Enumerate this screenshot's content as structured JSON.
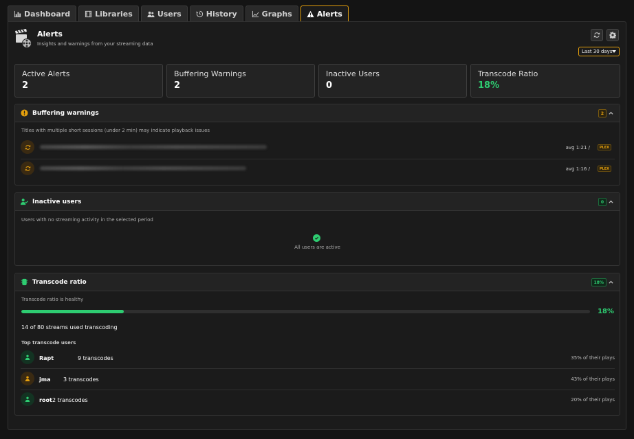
{
  "nav": {
    "tabs": [
      {
        "label": "Dashboard",
        "icon": "bar-chart-icon"
      },
      {
        "label": "Libraries",
        "icon": "film-icon"
      },
      {
        "label": "Users",
        "icon": "users-icon"
      },
      {
        "label": "History",
        "icon": "history-icon"
      },
      {
        "label": "Graphs",
        "icon": "line-chart-icon"
      },
      {
        "label": "Alerts",
        "icon": "warning-icon"
      }
    ],
    "active": "Alerts"
  },
  "header": {
    "title": "Alerts",
    "subtitle": "Insights and warnings from your streaming data",
    "range_select": "Last 30 days"
  },
  "stats": [
    {
      "label": "Active Alerts",
      "value": "2"
    },
    {
      "label": "Buffering Warnings",
      "value": "2"
    },
    {
      "label": "Inactive Users",
      "value": "0"
    },
    {
      "label": "Transcode Ratio",
      "value": "18%"
    }
  ],
  "buffering": {
    "title": "Buffering warnings",
    "badge": "2",
    "description": "Titles with multiple short sessions (under 2 min) may indicate playback issues",
    "rows": [
      {
        "avg": "avg 1:21 /",
        "server": "PLEX"
      },
      {
        "avg": "avg 1:16 /",
        "server": "PLEX"
      }
    ]
  },
  "inactive": {
    "title": "Inactive users",
    "badge": "0",
    "description": "Users with no streaming activity in the selected period",
    "empty": "All users are active"
  },
  "transcode": {
    "title": "Transcode ratio",
    "badge": "18%",
    "description": "Transcode ratio is healthy",
    "ratio_percent": 18,
    "ratio_label": "18%",
    "summary": "14 of 80 streams used transcoding",
    "top_label": "Top transcode users",
    "users": [
      {
        "name": "Rapt",
        "count": "9 transcodes",
        "share": "35% of their plays"
      },
      {
        "name": "jma",
        "count": "3 transcodes",
        "share": "43% of their plays"
      },
      {
        "name": "root",
        "count": "2 transcodes",
        "share": "20% of their plays"
      }
    ]
  },
  "colors": {
    "accent": "#e5a00d",
    "success": "#2ecc71"
  }
}
